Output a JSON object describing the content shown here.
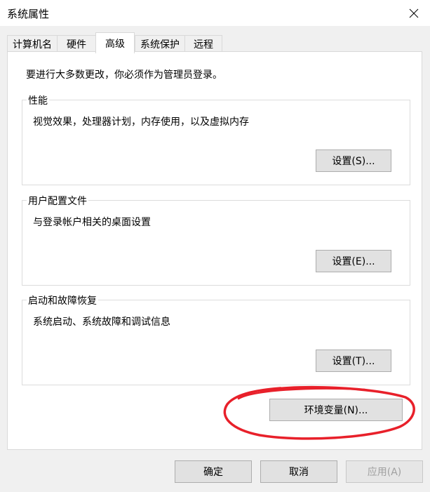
{
  "window": {
    "title": "系统属性",
    "close_icon": "close-icon"
  },
  "tabs": [
    {
      "label": "计算机名"
    },
    {
      "label": "硬件"
    },
    {
      "label": "高级",
      "active": true
    },
    {
      "label": "系统保护"
    },
    {
      "label": "远程"
    }
  ],
  "admin_note": "要进行大多数更改，你必须作为管理员登录。",
  "groups": {
    "performance": {
      "title": "性能",
      "description": "视觉效果，处理器计划，内存使用，以及虚拟内存",
      "button": "设置(S)..."
    },
    "user_profiles": {
      "title": "用户配置文件",
      "description": "与登录帐户相关的桌面设置",
      "button": "设置(E)..."
    },
    "startup_recovery": {
      "title": "启动和故障恢复",
      "description": "系统启动、系统故障和调试信息",
      "button": "设置(T)..."
    }
  },
  "env_button": "环境变量(N)...",
  "footer": {
    "ok": "确定",
    "cancel": "取消",
    "apply": "应用(A)"
  },
  "colors": {
    "annotation": "#e8202a"
  }
}
